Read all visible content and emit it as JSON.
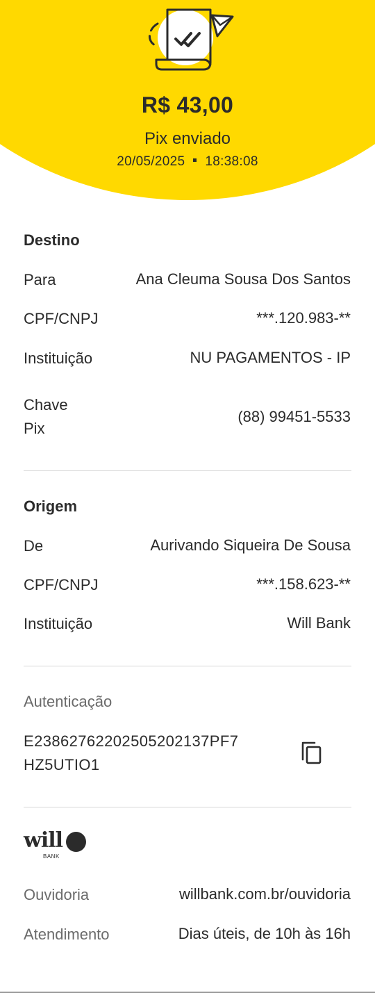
{
  "header": {
    "amount": "R$ 43,00",
    "status": "Pix enviado",
    "date": "20/05/2025",
    "time": "18:38:08",
    "icon": "receipt-sent-icon",
    "accent_color": "#FFD900"
  },
  "destino": {
    "title": "Destino",
    "rows": [
      {
        "label": "Para",
        "value": "Ana Cleuma Sousa Dos Santos"
      },
      {
        "label": "CPF/CNPJ",
        "value": "***.120.983-**"
      },
      {
        "label": "Instituição",
        "value": "NU PAGAMENTOS - IP"
      },
      {
        "label_line1": "Chave",
        "label_line2": "Pix",
        "value": "(88) 99451-5533"
      }
    ]
  },
  "origem": {
    "title": "Origem",
    "rows": [
      {
        "label": "De",
        "value": "Aurivando Siqueira De Sousa"
      },
      {
        "label": "CPF/CNPJ",
        "value": "***.158.623-**"
      },
      {
        "label": "Instituição",
        "value": "Will Bank"
      }
    ]
  },
  "autenticacao": {
    "title": "Autenticação",
    "code_line1": "E23862762202505202137PF7",
    "code_line2": "HZ5UTIO1",
    "copy_icon": "copy-icon"
  },
  "footer": {
    "logo_word": "will",
    "logo_sub": "BANK",
    "rows": [
      {
        "label": "Ouvidoria",
        "value": "willbank.com.br/ouvidoria"
      },
      {
        "label": "Atendimento",
        "value": "Dias úteis, de 10h às 16h"
      }
    ]
  }
}
